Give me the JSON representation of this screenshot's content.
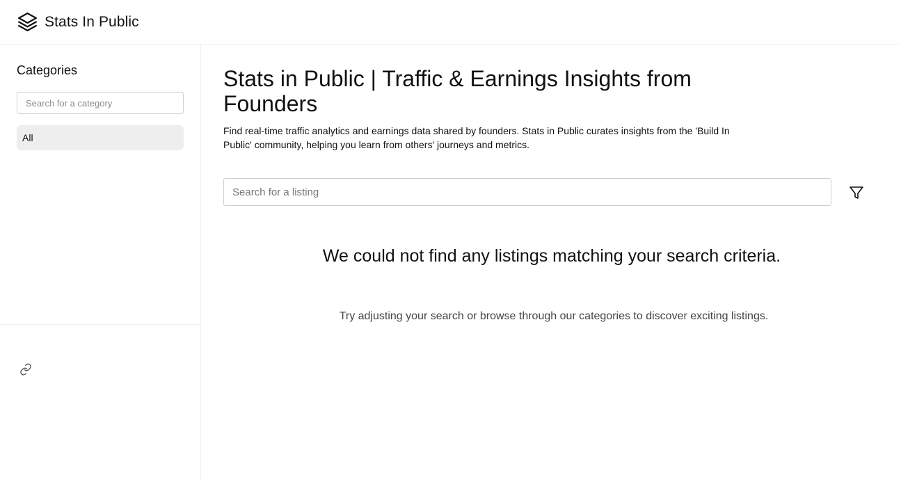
{
  "header": {
    "brand": "Stats In Public",
    "logo_icon": "layers-icon"
  },
  "sidebar": {
    "title": "Categories",
    "search_placeholder": "Search for a category",
    "items": [
      {
        "label": "All",
        "selected": true
      }
    ],
    "footer_icon": "link-icon"
  },
  "main": {
    "title": "Stats in Public | Traffic & Earnings Insights from Founders",
    "description": "Find real-time traffic analytics and earnings data shared by founders. Stats in Public curates insights from the 'Build In Public' community, helping you learn from others' journeys and metrics.",
    "search_placeholder": "Search for a listing",
    "filter_icon": "filter-icon",
    "empty_title": "We could not find any listings matching your search criteria.",
    "empty_description": "Try adjusting your search or browse through our categories to discover exciting listings."
  },
  "colors": {
    "text": "#111111",
    "muted": "#444444",
    "border": "#cfcfcf",
    "divider": "#f0f0f0",
    "selected_bg": "#eeeeee"
  }
}
